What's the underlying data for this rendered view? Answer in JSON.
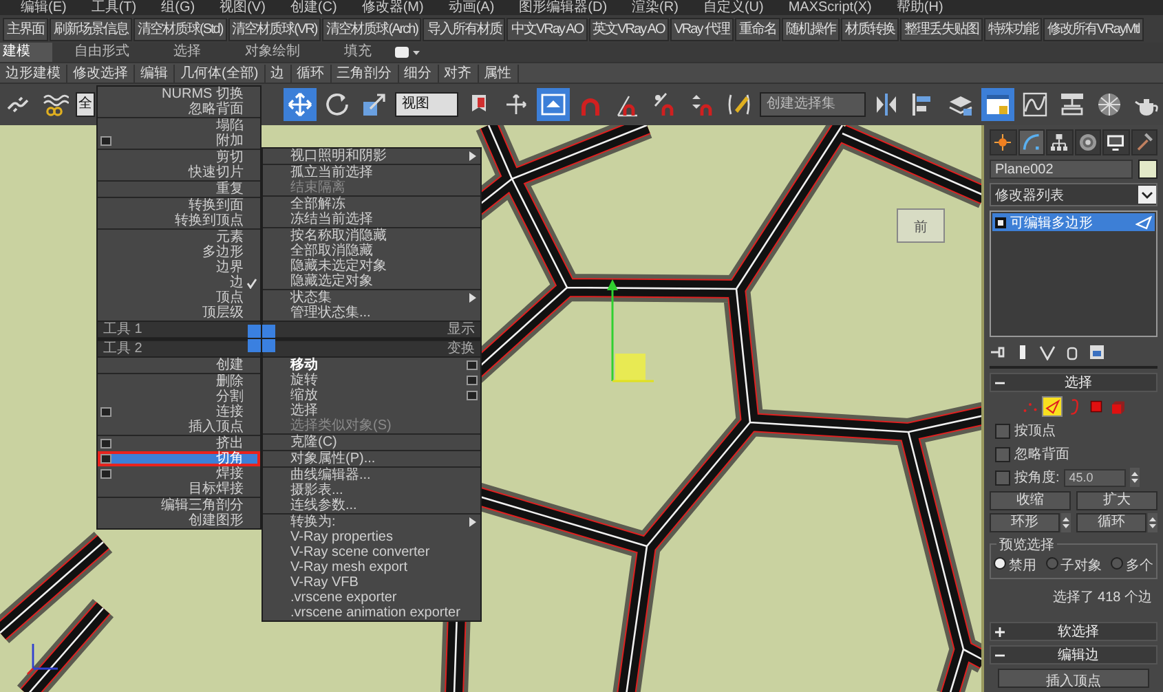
{
  "menu_bar": [
    "编辑(E)",
    "工具(T)",
    "组(G)",
    "视图(V)",
    "创建(C)",
    "修改器(M)",
    "动画(A)",
    "图形编辑器(D)",
    "渲染(R)",
    "自定义(U)",
    "MAXScript(X)",
    "帮助(H)"
  ],
  "custom_toolbar": [
    "主界面",
    "刷新场景信息",
    "清空材质球(Std)",
    "清空材质球(VR)",
    "清空材质球(Arch)",
    "导入所有材质",
    "中文VRay AO",
    "英文VRay AO",
    "VRay 代理",
    "重命名",
    "随机操作",
    "材质转换",
    "整理丢失贴图",
    "特殊功能",
    "修改所有VRayMtl"
  ],
  "ribbon": {
    "tabs": [
      {
        "label": "建模",
        "selected": true
      },
      {
        "label": "自由形式",
        "selected": false
      },
      {
        "label": "选择",
        "selected": false
      },
      {
        "label": "对象绘制",
        "selected": false
      },
      {
        "label": "填充",
        "selected": false
      }
    ],
    "panels": [
      "边形建模",
      "修改选择",
      "编辑",
      "几何体(全部)",
      "边",
      "循环",
      "三角剖分",
      "细分",
      "对齐",
      "属性"
    ]
  },
  "main_toolbar": {
    "items": [
      {
        "kind": "link",
        "active": false
      },
      {
        "kind": "bind",
        "active": false
      },
      {
        "kind": "dropdown",
        "value": "全",
        "active": false
      },
      {
        "kind": "move",
        "active": true
      },
      {
        "kind": "rotate",
        "active": false
      },
      {
        "kind": "scale",
        "active": false
      },
      {
        "kind": "dropdown",
        "value": "视图",
        "active": false
      },
      {
        "kind": "pin",
        "active": false
      },
      {
        "kind": "crosshair",
        "active": false
      },
      {
        "kind": "keyboard",
        "active": true
      },
      {
        "kind": "snap",
        "active": false
      },
      {
        "kind": "angle-snap",
        "active": false
      },
      {
        "kind": "percent-snap",
        "active": false
      },
      {
        "kind": "spinner-snap",
        "active": false
      },
      {
        "kind": "edit-named",
        "active": false
      },
      {
        "kind": "dropdown",
        "value": "创建选择集",
        "active": false
      },
      {
        "kind": "mirror",
        "active": false
      },
      {
        "kind": "align",
        "active": false
      },
      {
        "kind": "layers",
        "active": false
      },
      {
        "kind": "explorer",
        "active": true
      },
      {
        "kind": "curve",
        "active": false
      },
      {
        "kind": "schematic",
        "active": false
      },
      {
        "kind": "material",
        "active": false
      },
      {
        "kind": "teapot",
        "active": false
      }
    ]
  },
  "viewport": {
    "viewcube_label": "前"
  },
  "quad_menu": {
    "quadrants": [
      {
        "kind": "top-left",
        "header": "工具 1",
        "sections": [
          [
            {
              "label": "NURMS 切换",
              "kind": "plain",
              "checked": false,
              "selected": false,
              "disabled": false,
              "default": false
            },
            {
              "label": "忽略背面",
              "kind": "plain",
              "checked": false,
              "selected": false,
              "disabled": false,
              "default": false
            }
          ],
          [
            {
              "label": "塌陷",
              "kind": "plain",
              "checked": false,
              "selected": false,
              "disabled": false,
              "default": false
            },
            {
              "label": "附加",
              "kind": "option",
              "checked": false,
              "selected": false,
              "disabled": false,
              "default": false
            }
          ],
          [
            {
              "label": "剪切",
              "kind": "plain",
              "checked": false,
              "selected": false,
              "disabled": false,
              "default": false
            },
            {
              "label": "快速切片",
              "kind": "plain",
              "checked": false,
              "selected": false,
              "disabled": false,
              "default": false
            }
          ],
          [
            {
              "label": "重复",
              "kind": "plain",
              "checked": false,
              "selected": false,
              "disabled": false,
              "default": false
            }
          ],
          [
            {
              "label": "转换到面",
              "kind": "plain",
              "checked": false,
              "selected": false,
              "disabled": false,
              "default": false
            },
            {
              "label": "转换到顶点",
              "kind": "plain",
              "checked": false,
              "selected": false,
              "disabled": false,
              "default": false
            }
          ],
          [
            {
              "label": "元素",
              "kind": "plain",
              "checked": false,
              "selected": false,
              "disabled": false,
              "default": false
            },
            {
              "label": "多边形",
              "kind": "plain",
              "checked": false,
              "selected": false,
              "disabled": false,
              "default": false
            },
            {
              "label": "边界",
              "kind": "plain",
              "checked": false,
              "selected": false,
              "disabled": false,
              "default": false
            },
            {
              "label": "边",
              "kind": "plain",
              "checked": true,
              "selected": false,
              "disabled": false,
              "default": false
            },
            {
              "label": "顶点",
              "kind": "plain",
              "checked": false,
              "selected": false,
              "disabled": false,
              "default": false
            },
            {
              "label": "顶层级",
              "kind": "plain",
              "checked": false,
              "selected": false,
              "disabled": false,
              "default": false
            }
          ]
        ]
      },
      {
        "kind": "top-right",
        "header": "显示",
        "sections": [
          [
            {
              "label": "视口照明和阴影",
              "kind": "submenu",
              "checked": false,
              "selected": false,
              "disabled": false,
              "default": false
            }
          ],
          [
            {
              "label": "孤立当前选择",
              "kind": "plain",
              "checked": false,
              "selected": false,
              "disabled": false,
              "default": false
            },
            {
              "label": "结束隔离",
              "kind": "plain",
              "checked": false,
              "selected": false,
              "disabled": true,
              "default": false
            }
          ],
          [
            {
              "label": "全部解冻",
              "kind": "plain",
              "checked": false,
              "selected": false,
              "disabled": false,
              "default": false
            },
            {
              "label": "冻结当前选择",
              "kind": "plain",
              "checked": false,
              "selected": false,
              "disabled": false,
              "default": false
            }
          ],
          [
            {
              "label": "按名称取消隐藏",
              "kind": "plain",
              "checked": false,
              "selected": false,
              "disabled": false,
              "default": false
            },
            {
              "label": "全部取消隐藏",
              "kind": "plain",
              "checked": false,
              "selected": false,
              "disabled": false,
              "default": false
            },
            {
              "label": "隐藏未选定对象",
              "kind": "plain",
              "checked": false,
              "selected": false,
              "disabled": false,
              "default": false
            },
            {
              "label": "隐藏选定对象",
              "kind": "plain",
              "checked": false,
              "selected": false,
              "disabled": false,
              "default": false
            }
          ],
          [
            {
              "label": "状态集",
              "kind": "submenu",
              "checked": false,
              "selected": false,
              "disabled": false,
              "default": false
            },
            {
              "label": "管理状态集...",
              "kind": "plain",
              "checked": false,
              "selected": false,
              "disabled": false,
              "default": false
            }
          ]
        ]
      },
      {
        "kind": "bottom-left",
        "header": "工具 2",
        "sections": [
          [
            {
              "label": "创建",
              "kind": "plain",
              "checked": false,
              "selected": false,
              "disabled": false,
              "default": false
            }
          ],
          [
            {
              "label": "删除",
              "kind": "plain",
              "checked": false,
              "selected": false,
              "disabled": false,
              "default": false
            },
            {
              "label": "分割",
              "kind": "plain",
              "checked": false,
              "selected": false,
              "disabled": false,
              "default": false
            },
            {
              "label": "连接",
              "kind": "option",
              "checked": false,
              "selected": false,
              "disabled": false,
              "default": false
            },
            {
              "label": "插入顶点",
              "kind": "plain",
              "checked": false,
              "selected": false,
              "disabled": false,
              "default": false
            }
          ],
          [
            {
              "label": "挤出",
              "kind": "option",
              "checked": false,
              "selected": false,
              "disabled": false,
              "default": false
            },
            {
              "label": "切角",
              "kind": "option",
              "checked": false,
              "selected": true,
              "disabled": false,
              "default": false
            },
            {
              "label": "焊接",
              "kind": "option",
              "checked": false,
              "selected": false,
              "disabled": false,
              "default": false
            },
            {
              "label": "目标焊接",
              "kind": "plain",
              "checked": false,
              "selected": false,
              "disabled": false,
              "default": false
            }
          ],
          [
            {
              "label": "编辑三角剖分",
              "kind": "plain",
              "checked": false,
              "selected": false,
              "disabled": false,
              "default": false
            },
            {
              "label": "创建图形",
              "kind": "plain",
              "checked": false,
              "selected": false,
              "disabled": false,
              "default": false
            }
          ]
        ]
      },
      {
        "kind": "bottom-right",
        "header": "变换",
        "sections": [
          [
            {
              "label": "移动",
              "kind": "option",
              "checked": false,
              "selected": false,
              "disabled": false,
              "default": true
            },
            {
              "label": "旋转",
              "kind": "option",
              "checked": false,
              "selected": false,
              "disabled": false,
              "default": false
            },
            {
              "label": "缩放",
              "kind": "option",
              "checked": false,
              "selected": false,
              "disabled": false,
              "default": false
            },
            {
              "label": "选择",
              "kind": "plain",
              "checked": false,
              "selected": false,
              "disabled": false,
              "default": false
            },
            {
              "label": "选择类似对象(S)",
              "kind": "plain",
              "checked": false,
              "selected": false,
              "disabled": true,
              "default": false
            }
          ],
          [
            {
              "label": "克隆(C)",
              "kind": "plain",
              "checked": false,
              "selected": false,
              "disabled": false,
              "default": false
            }
          ],
          [
            {
              "label": "对象属性(P)...",
              "kind": "plain",
              "checked": false,
              "selected": false,
              "disabled": false,
              "default": false
            }
          ],
          [
            {
              "label": "曲线编辑器...",
              "kind": "plain",
              "checked": false,
              "selected": false,
              "disabled": false,
              "default": false
            },
            {
              "label": "摄影表...",
              "kind": "plain",
              "checked": false,
              "selected": false,
              "disabled": false,
              "default": false
            },
            {
              "label": "连线参数...",
              "kind": "plain",
              "checked": false,
              "selected": false,
              "disabled": false,
              "default": false
            }
          ],
          [
            {
              "label": "转换为:",
              "kind": "submenu",
              "checked": false,
              "selected": false,
              "disabled": false,
              "default": false
            },
            {
              "label": "V-Ray properties",
              "kind": "plain",
              "checked": false,
              "selected": false,
              "disabled": false,
              "default": false
            },
            {
              "label": "V-Ray scene converter",
              "kind": "plain",
              "checked": false,
              "selected": false,
              "disabled": false,
              "default": false
            },
            {
              "label": "V-Ray mesh export",
              "kind": "plain",
              "checked": false,
              "selected": false,
              "disabled": false,
              "default": false
            },
            {
              "label": "V-Ray VFB",
              "kind": "plain",
              "checked": false,
              "selected": false,
              "disabled": false,
              "default": false
            },
            {
              "label": ".vrscene exporter",
              "kind": "plain",
              "checked": false,
              "selected": false,
              "disabled": false,
              "default": false
            },
            {
              "label": ".vrscene animation exporter",
              "kind": "plain",
              "checked": false,
              "selected": false,
              "disabled": false,
              "default": false
            }
          ]
        ]
      }
    ]
  },
  "command_panel": {
    "tabs": [
      {
        "kind": "create",
        "selected": false
      },
      {
        "kind": "modify",
        "selected": true
      },
      {
        "kind": "hierarchy",
        "selected": false
      },
      {
        "kind": "motion",
        "selected": false
      },
      {
        "kind": "display",
        "selected": false
      },
      {
        "kind": "utilities",
        "selected": false
      }
    ],
    "object_name": "Plane002",
    "modifier_list": "修改器列表",
    "stack": [
      {
        "label": "可编辑多边形",
        "selected": true
      }
    ],
    "selection_rollout": {
      "title": "选择",
      "expanded": true,
      "subobject_levels": [
        {
          "kind": "vertex",
          "selected": false
        },
        {
          "kind": "edge",
          "selected": true
        },
        {
          "kind": "border",
          "selected": false
        },
        {
          "kind": "polygon",
          "selected": false
        },
        {
          "kind": "element",
          "selected": false
        }
      ],
      "options": [
        {
          "label": "按顶点",
          "checked": false
        },
        {
          "label": "忽略背面",
          "checked": false
        },
        {
          "label": "按角度:",
          "checked": false,
          "value": "45.0"
        }
      ],
      "buttons": [
        {
          "label": "收缩",
          "kind": "plain"
        },
        {
          "label": "扩大",
          "kind": "plain"
        },
        {
          "label": "环形",
          "kind": "spinner"
        },
        {
          "label": "循环",
          "kind": "spinner"
        }
      ],
      "preview_selection": {
        "title": "预览选择",
        "options": [
          {
            "label": "禁用",
            "selected": true
          },
          {
            "label": "子对象",
            "selected": false
          },
          {
            "label": "多个",
            "selected": false
          }
        ]
      },
      "status": "选择了 418 个边"
    },
    "soft_selection_rollout": {
      "title": "软选择",
      "expanded": false
    },
    "edit_edges_rollout": {
      "title": "编辑边",
      "expanded": true,
      "buttons": [
        "插入顶点"
      ]
    }
  }
}
